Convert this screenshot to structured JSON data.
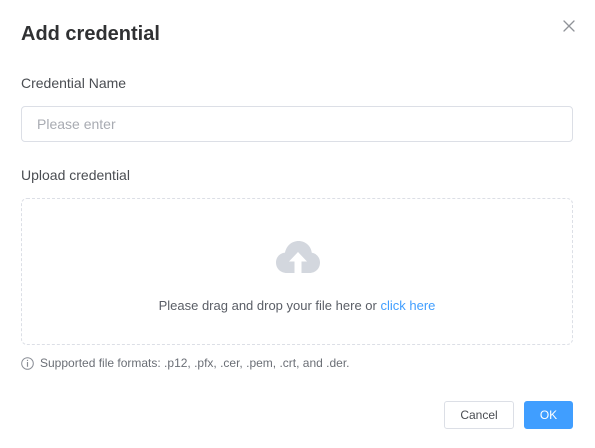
{
  "dialog": {
    "title": "Add credential"
  },
  "form": {
    "name_label": "Credential Name",
    "name_value": "",
    "name_placeholder": "Please enter",
    "upload_label": "Upload credential"
  },
  "dropzone": {
    "text": "Please drag and drop your file here or",
    "link": "click here",
    "icon": "cloud-upload-icon"
  },
  "hint": {
    "icon": "info-icon",
    "text": "Supported file formats: .p12, .pfx, .cer, .pem, .crt, and .der."
  },
  "footer": {
    "cancel_label": "Cancel",
    "ok_label": "OK"
  },
  "colors": {
    "primary": "#409eff",
    "title": "#303133",
    "border": "#dcdfe6",
    "icon_gray": "#d3d7de"
  }
}
